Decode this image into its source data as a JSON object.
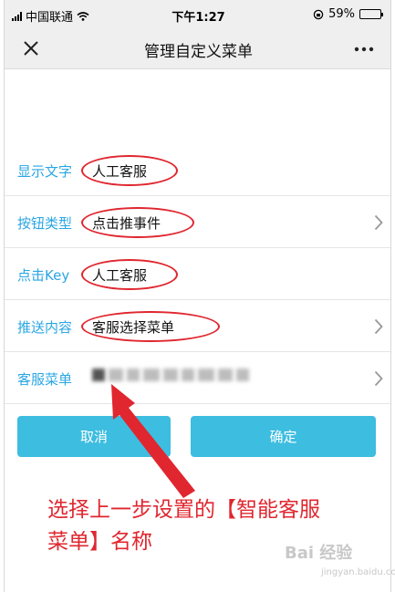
{
  "status_bar": {
    "carrier": "中国联通",
    "time": "下午1:27",
    "battery_percent": "59%",
    "battery_level": 0.59
  },
  "nav": {
    "title": "管理自定义菜单"
  },
  "form": {
    "rows": [
      {
        "label": "显示文字",
        "value": "人工客服"
      },
      {
        "label": "按钮类型",
        "value": "点击推事件"
      },
      {
        "label": "点击Key",
        "value": "人工客服"
      },
      {
        "label": "推送内容",
        "value": "客服选择菜单"
      },
      {
        "label": "客服菜单",
        "value": ""
      }
    ]
  },
  "buttons": {
    "cancel": "取消",
    "confirm": "确定"
  },
  "annotation": {
    "line1": "选择上一步设置的【智能客服",
    "line2": "菜单】名称"
  },
  "watermark": {
    "logo": "Bai 经验",
    "url": "jingyan.baidu.com"
  },
  "colors": {
    "label": "#2aa6e3",
    "button": "#3dbde0",
    "annotation_red": "#e0262f",
    "bar_bg": "#efefef"
  }
}
